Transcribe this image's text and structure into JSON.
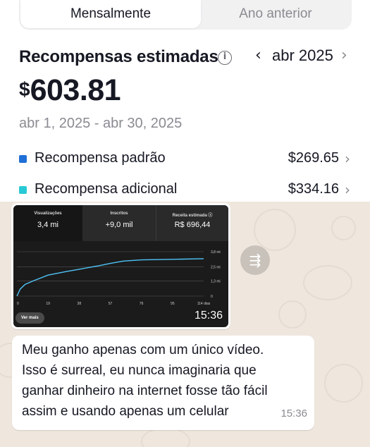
{
  "tabs": {
    "active": "Mensalmente",
    "inactive": "Ano anterior"
  },
  "rewards": {
    "heading": "Recompensas estimadas",
    "info_glyph": "i",
    "month": "abr 2025",
    "prev_glyph": "‹",
    "next_glyph": "›",
    "currency": "$",
    "amount": "603.81",
    "date_range": "abr 1, 2025 - abr 30, 2025"
  },
  "breakdown": [
    {
      "label": "Recompensa padrão",
      "value": "$269.65",
      "color": "#1f6fd6"
    },
    {
      "label": "Recompensa adicional",
      "value": "$334.16",
      "color": "#28c9d6"
    }
  ],
  "chevron_glyph": "›",
  "media": {
    "stats": [
      {
        "label": "Visualizações",
        "value": "3,4 mi"
      },
      {
        "label": "Inscritos",
        "value": "+9,0 mil"
      },
      {
        "label": "Receita estimada ⓢ",
        "value": "R$ 696,44"
      }
    ],
    "chart_data": {
      "type": "line",
      "x_ticks": [
        "0",
        "19",
        "38",
        "57",
        "76",
        "95",
        "114 dias"
      ],
      "y_ticks": [
        "3,8 mi",
        "2,5 mi",
        "1,3 mi",
        "0"
      ],
      "series": [
        {
          "x": [
            0,
            2,
            5,
            10,
            19,
            30,
            38,
            50,
            57,
            65,
            76,
            95,
            114
          ],
          "y": [
            0,
            0.6,
            1.0,
            1.3,
            1.8,
            2.1,
            2.3,
            2.6,
            2.8,
            3.0,
            3.1,
            3.15,
            3.2
          ]
        }
      ],
      "line_color": "#4fc3f7",
      "ylim": [
        0,
        3.8
      ],
      "xlim": [
        0,
        114
      ]
    },
    "button": "Ver mais",
    "time": "15:36"
  },
  "forward_glyph": "⇶",
  "message": {
    "lines": [
      "Meu ganho apenas com um único vídeo.",
      "Isso é surreal, eu nunca imaginaria que",
      "ganhar dinheiro na internet fosse tão fácil",
      "assim e usando apenas um celular"
    ],
    "time": "15:36"
  }
}
